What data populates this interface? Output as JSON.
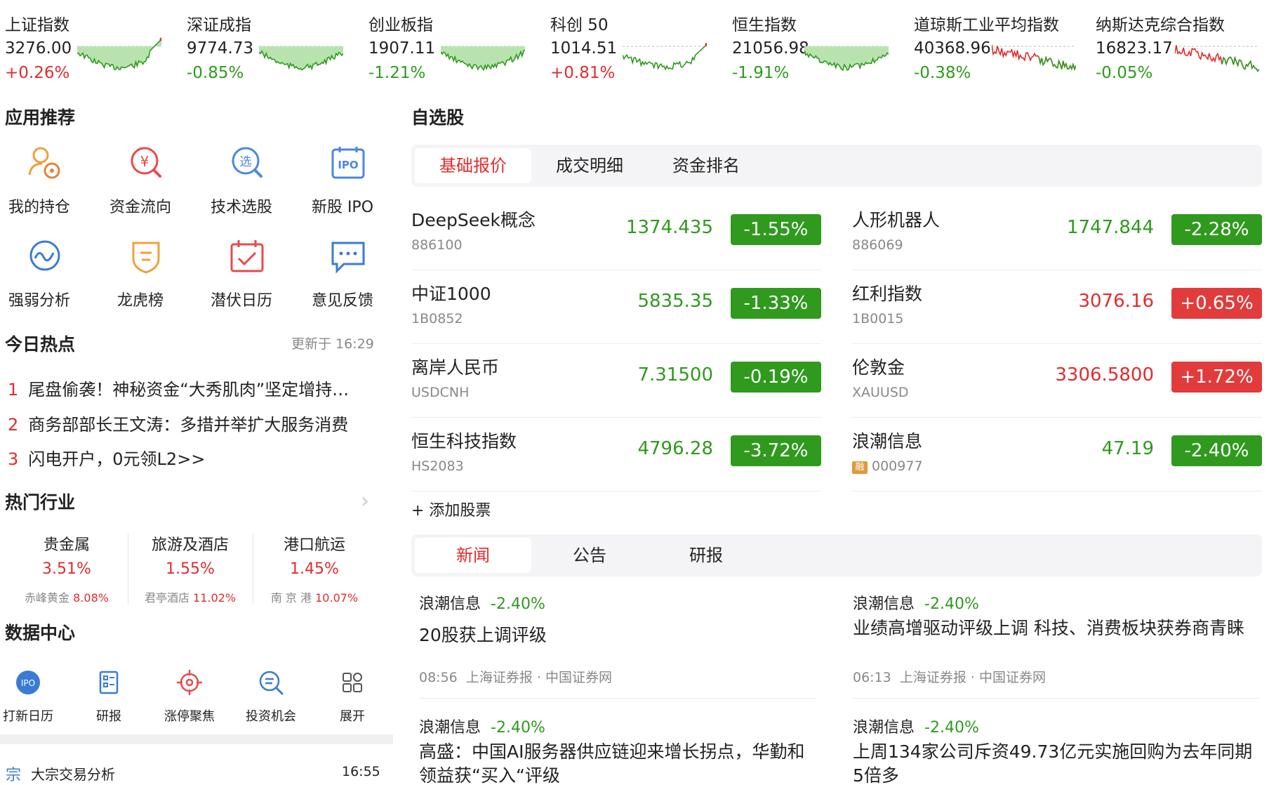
{
  "indices": [
    {
      "name": "上证指数",
      "value": "3276.00",
      "change": "+0.26%",
      "trend": "up",
      "chart": "fill-dip"
    },
    {
      "name": "深证成指",
      "value": "9774.73",
      "change": "-0.85%",
      "trend": "down",
      "chart": "fill-dip"
    },
    {
      "name": "创业板指",
      "value": "1907.11",
      "change": "-1.21%",
      "trend": "down",
      "chart": "fill-dip"
    },
    {
      "name": "科创 50",
      "value": "1014.51",
      "change": "+0.81%",
      "trend": "up",
      "chart": "line-mixed"
    },
    {
      "name": "恒生指数",
      "value": "21056.98",
      "change": "-1.91%",
      "trend": "down",
      "chart": "fill-dip"
    },
    {
      "name": "道琼斯工业平均指数",
      "value": "40368.96",
      "change": "-0.38%",
      "trend": "down",
      "chart": "line-fall"
    },
    {
      "name": "纳斯达克综合指数",
      "value": "16823.17",
      "change": "-0.05%",
      "trend": "down",
      "chart": "line-fall"
    }
  ],
  "apps": {
    "title": "应用推荐",
    "items": [
      {
        "label": "我的持仓",
        "icon": "holdings-icon"
      },
      {
        "label": "资金流向",
        "icon": "money-flow-icon"
      },
      {
        "label": "技术选股",
        "icon": "stock-picker-icon"
      },
      {
        "label": "新股 IPO",
        "icon": "ipo-icon"
      },
      {
        "label": "强弱分析",
        "icon": "strength-analysis-icon"
      },
      {
        "label": "龙虎榜",
        "icon": "dragon-tiger-icon"
      },
      {
        "label": "潜伏日历",
        "icon": "calendar-icon"
      },
      {
        "label": "意见反馈",
        "icon": "feedback-icon"
      }
    ]
  },
  "hot": {
    "title": "今日热点",
    "updated": "更新于 16:29",
    "items": [
      {
        "num": "1",
        "text": "尾盘偷袭！神秘资金“大秀肌肉”坚定增持…"
      },
      {
        "num": "2",
        "text": "商务部部长王文涛：多措并举扩大服务消费"
      },
      {
        "num": "3",
        "text": "闪电开户，0元领L2>>"
      }
    ]
  },
  "industry": {
    "title": "热门行业",
    "items": [
      {
        "name": "贵金属",
        "change": "3.51%",
        "leader": "赤峰黄金",
        "leader_change": "8.08%"
      },
      {
        "name": "旅游及酒店",
        "change": "1.55%",
        "leader": "君亭酒店",
        "leader_change": "11.02%"
      },
      {
        "name": "港口航运",
        "change": "1.45%",
        "leader": "南 京 港",
        "leader_change": "10.07%"
      }
    ]
  },
  "datacenter": {
    "title": "数据中心",
    "items": [
      {
        "label": "打新日历",
        "icon": "ipo-badge-icon"
      },
      {
        "label": "研报",
        "icon": "report-icon"
      },
      {
        "label": "涨停聚焦",
        "icon": "target-icon"
      },
      {
        "label": "投资机会",
        "icon": "opportunity-icon"
      },
      {
        "label": "展开",
        "icon": "grid-icon"
      }
    ]
  },
  "block_trade": {
    "tag": "宗",
    "title": "大宗交易分析",
    "time": "16:55"
  },
  "watchlist": {
    "title": "自选股",
    "tabs": [
      "基础报价",
      "成交明细",
      "资金排名"
    ],
    "stocks": [
      {
        "name": "DeepSeek概念",
        "code": "886100",
        "price": "1374.435",
        "change": "-1.55%",
        "trend": "down",
        "margin": false
      },
      {
        "name": "人形机器人",
        "code": "886069",
        "price": "1747.844",
        "change": "-2.28%",
        "trend": "down",
        "margin": false
      },
      {
        "name": "中证1000",
        "code": "1B0852",
        "price": "5835.35",
        "change": "-1.33%",
        "trend": "down",
        "margin": false
      },
      {
        "name": "红利指数",
        "code": "1B0015",
        "price": "3076.16",
        "change": "+0.65%",
        "trend": "up",
        "margin": false
      },
      {
        "name": "离岸人民币",
        "code": "USDCNH",
        "price": "7.31500",
        "change": "-0.19%",
        "trend": "down",
        "margin": false
      },
      {
        "name": "伦敦金",
        "code": "XAUUSD",
        "price": "3306.5800",
        "change": "+1.72%",
        "trend": "up",
        "margin": false
      },
      {
        "name": "恒生科技指数",
        "code": "HS2083",
        "price": "4796.28",
        "change": "-3.72%",
        "trend": "down",
        "margin": false
      },
      {
        "name": "浪潮信息",
        "code": "000977",
        "price": "47.19",
        "change": "-2.40%",
        "trend": "down",
        "margin": true,
        "margin_tag": "融"
      }
    ],
    "add_label": "+ 添加股票"
  },
  "news": {
    "tabs": [
      "新闻",
      "公告",
      "研报"
    ],
    "items": [
      {
        "stock": "浪潮信息",
        "change": "-2.40%",
        "title": "20股获上调评级",
        "time": "08:56",
        "source": "上海证券报 · 中国证券网"
      },
      {
        "stock": "浪潮信息",
        "change": "-2.40%",
        "title": "业绩高增驱动评级上调 科技、消费板块获券商青睐",
        "time": "06:13",
        "source": "上海证券报 · 中国证券网"
      },
      {
        "stock": "浪潮信息",
        "change": "-2.40%",
        "title": "高盛：中国AI服务器供应链迎来增长拐点，华勤和领益获“买入“评级",
        "time": "",
        "source": ""
      },
      {
        "stock": "浪潮信息",
        "change": "-2.40%",
        "title": "上周134家公司斥资49.73亿元实施回购为去年同期5倍多",
        "time": "",
        "source": ""
      }
    ]
  },
  "colors": {
    "up": "#e02c2c",
    "down": "#2f9a1e",
    "accent": "#e02c2c",
    "link": "#3a7bd5"
  }
}
